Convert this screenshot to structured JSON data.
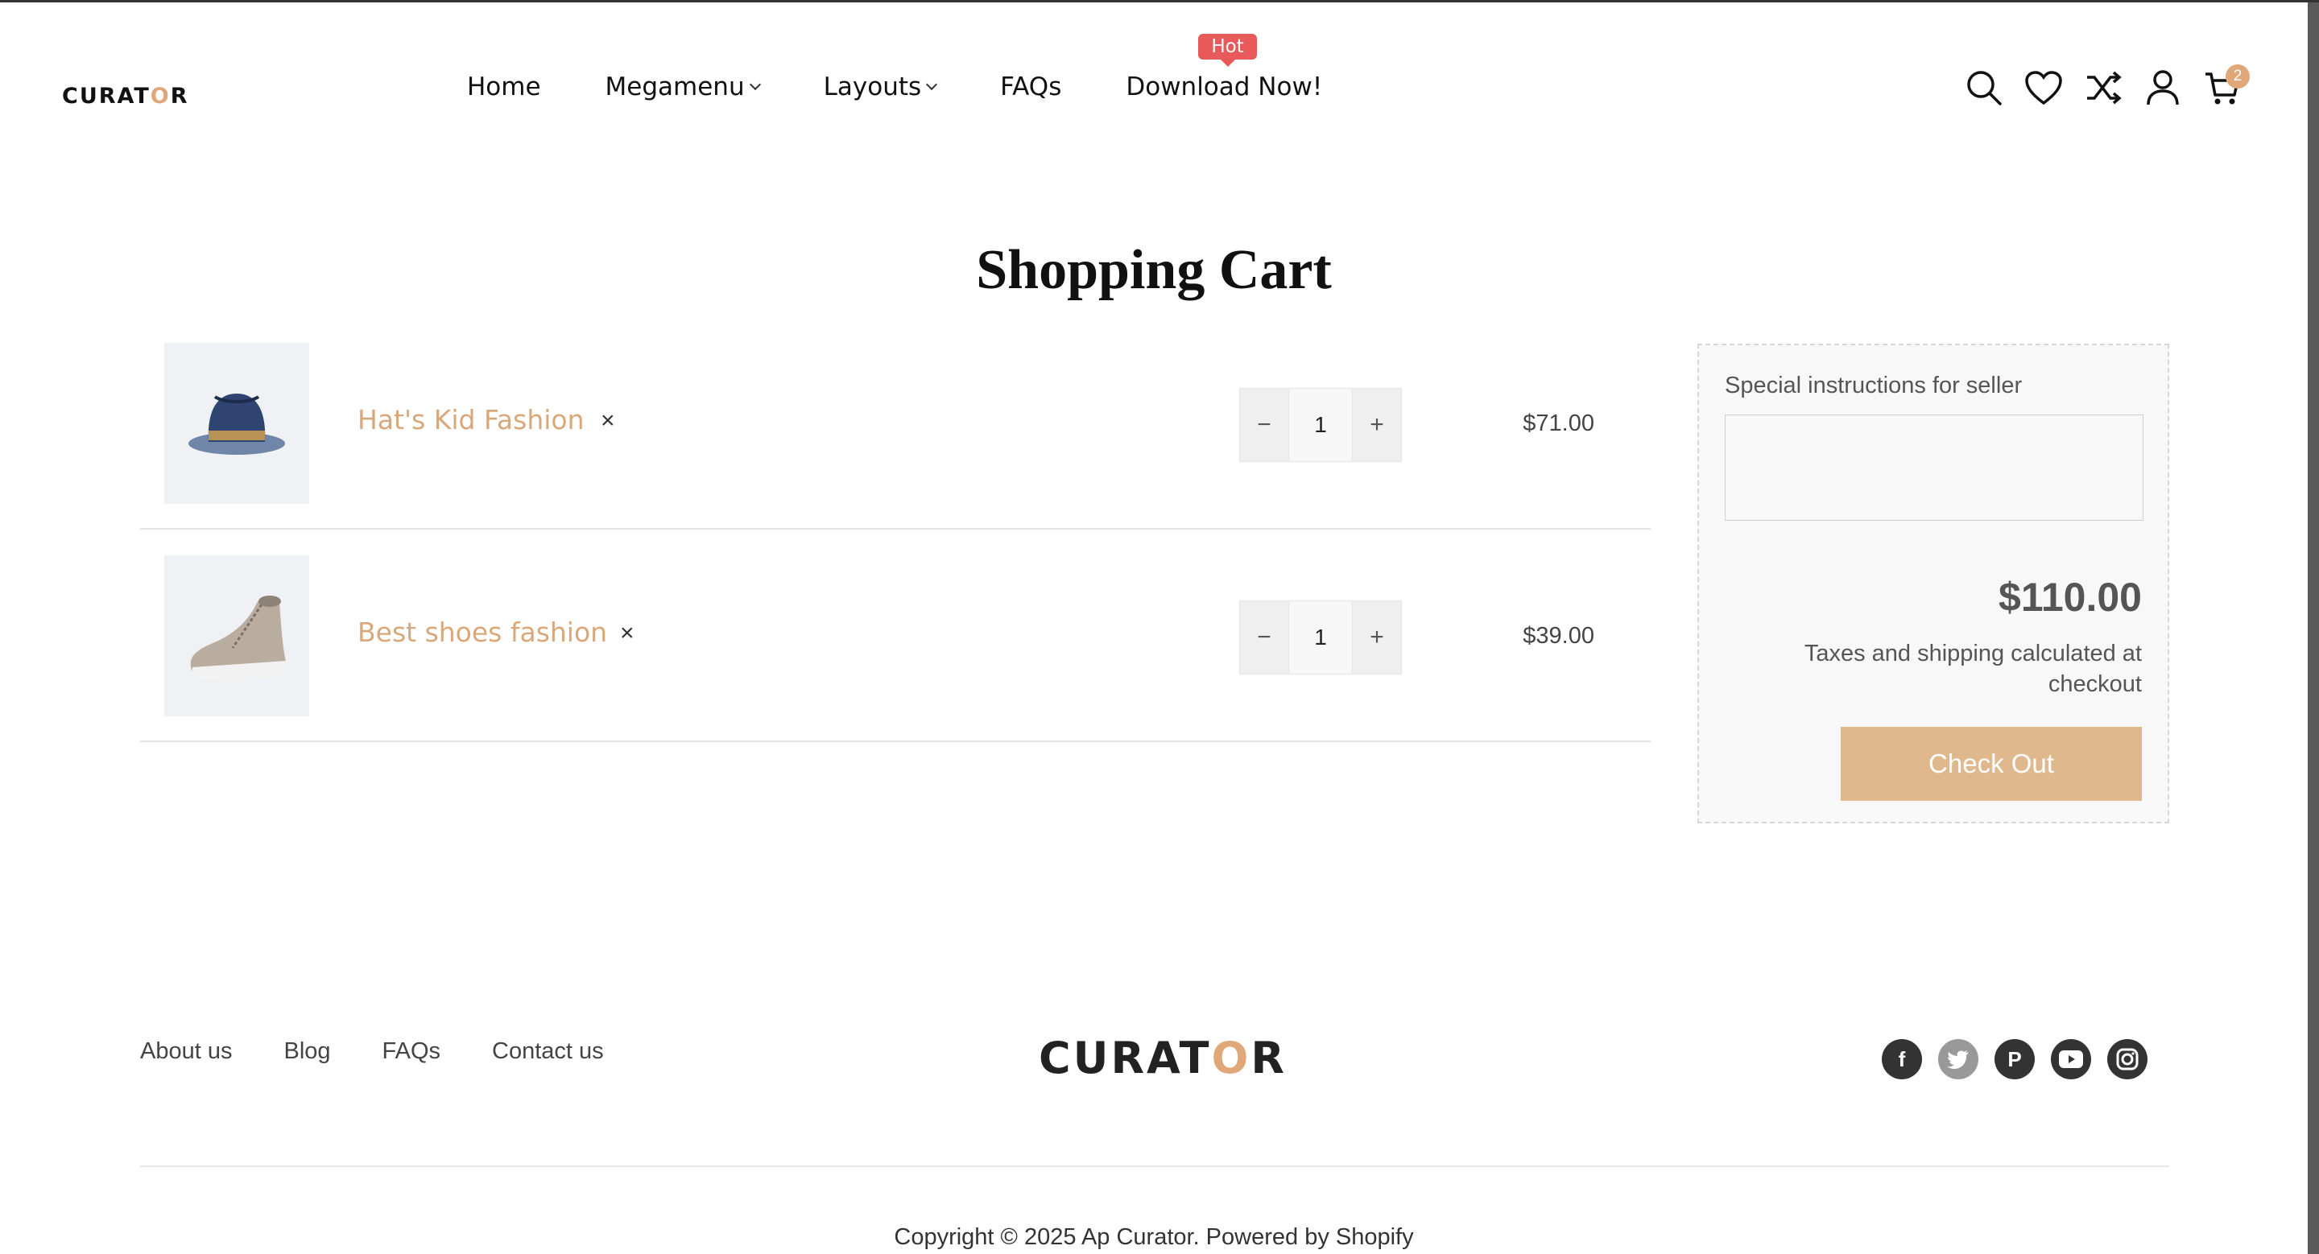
{
  "header": {
    "logo_text": "CURATOR",
    "nav": [
      {
        "label": "Home"
      },
      {
        "label": "Megamenu"
      },
      {
        "label": "Layouts"
      },
      {
        "label": "FAQs"
      },
      {
        "label": "Download Now!",
        "badge": "Hot"
      }
    ],
    "icons": [
      "search-icon",
      "heart-icon",
      "shuffle-icon",
      "user-icon",
      "cart-icon"
    ],
    "cart_count": "2"
  },
  "page": {
    "title": "Shopping Cart"
  },
  "cart": {
    "items": [
      {
        "name": "Hat's Kid Fashion",
        "remove": "×",
        "qty": "1",
        "price": "$71.00",
        "image": "hat"
      },
      {
        "name": "Best shoes fashion",
        "remove": "×",
        "qty": "1",
        "price": "$39.00",
        "image": "shoe"
      }
    ],
    "qty_minus": "−",
    "qty_plus": "+"
  },
  "summary": {
    "instructions_label": "Special instructions for seller",
    "instructions_value": "",
    "total": "$110.00",
    "tax_note": "Taxes and shipping calculated at checkout",
    "checkout_label": "Check Out"
  },
  "footer": {
    "links": [
      "About us",
      "Blog",
      "FAQs",
      "Contact us"
    ],
    "logo_text": "CURATOR",
    "socials": [
      "facebook-icon",
      "twitter-icon",
      "pinterest-icon",
      "youtube-icon",
      "instagram-icon"
    ],
    "copyright": "Copyright © 2025 Ap Curator. Powered by Shopify"
  },
  "colors": {
    "accent": "#e0b88d",
    "link": "#d9a87a",
    "hot_badge": "#e85a5a"
  }
}
